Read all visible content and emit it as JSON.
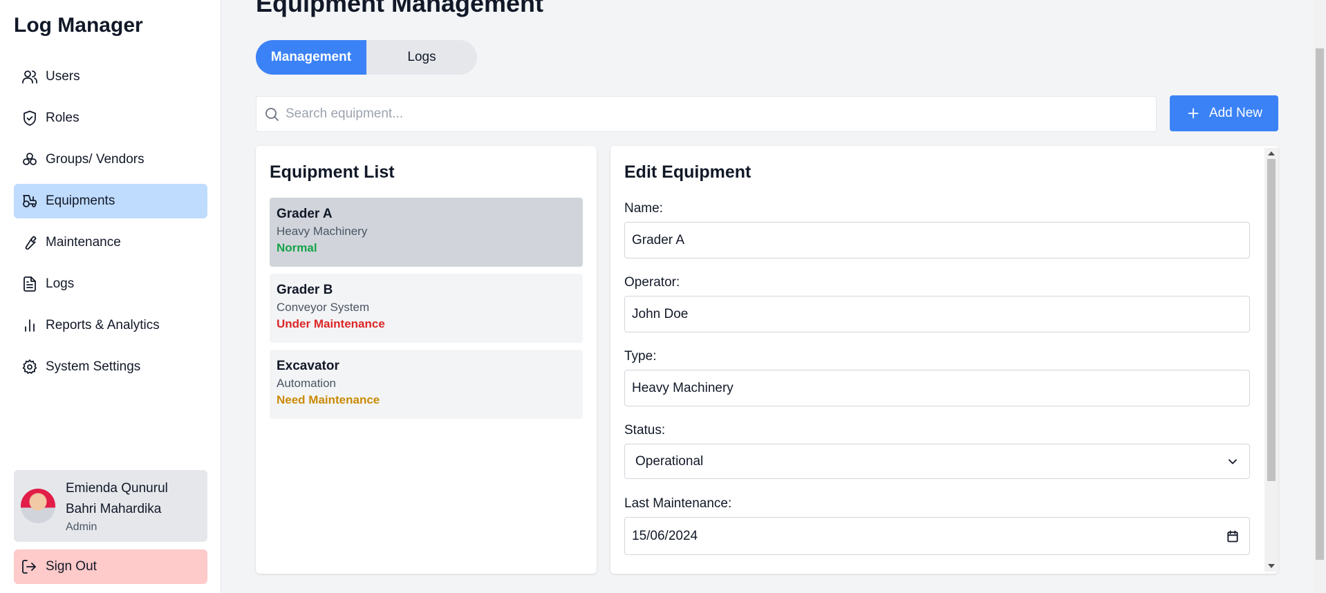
{
  "sidebar": {
    "brand": "Log Manager",
    "items": [
      {
        "label": "Users",
        "icon": "users-icon"
      },
      {
        "label": "Roles",
        "icon": "shield-icon"
      },
      {
        "label": "Groups/ Vendors",
        "icon": "groups-icon"
      },
      {
        "label": "Equipments",
        "icon": "tractor-icon",
        "active": true
      },
      {
        "label": "Maintenance",
        "icon": "wrench-icon"
      },
      {
        "label": "Logs",
        "icon": "document-icon"
      },
      {
        "label": "Reports & Analytics",
        "icon": "bar-chart-icon"
      },
      {
        "label": "System Settings",
        "icon": "gear-icon"
      }
    ],
    "user": {
      "name": "Emienda Qunurul Bahri Mahardika",
      "role": "Admin"
    },
    "sign_out": "Sign Out"
  },
  "main": {
    "title": "Equipment Management",
    "tabs": [
      {
        "label": "Management",
        "active": true
      },
      {
        "label": "Logs",
        "active": false
      }
    ],
    "search_placeholder": "Search equipment...",
    "add_button": "Add New"
  },
  "equipment_list": {
    "title": "Equipment List",
    "items": [
      {
        "name": "Grader A",
        "type": "Heavy Machinery",
        "status": "Normal",
        "status_color": "#16a34a",
        "selected": true
      },
      {
        "name": "Grader B",
        "type": "Conveyor System",
        "status": "Under Maintenance",
        "status_color": "#dc2626",
        "selected": false
      },
      {
        "name": "Excavator",
        "type": "Automation",
        "status": "Need Maintenance",
        "status_color": "#ca8a04",
        "selected": false
      }
    ]
  },
  "edit_form": {
    "title": "Edit Equipment",
    "name_label": "Name:",
    "name_value": "Grader A",
    "operator_label": "Operator:",
    "operator_value": "John Doe",
    "type_label": "Type:",
    "type_value": "Heavy Machinery",
    "status_label": "Status:",
    "status_value": "Operational",
    "last_maintenance_label": "Last Maintenance:",
    "last_maintenance_value": "15/06/2024"
  },
  "colors": {
    "accent": "#3b82f6",
    "active_nav": "#bfdbfe",
    "sign_out": "#fecaca"
  }
}
